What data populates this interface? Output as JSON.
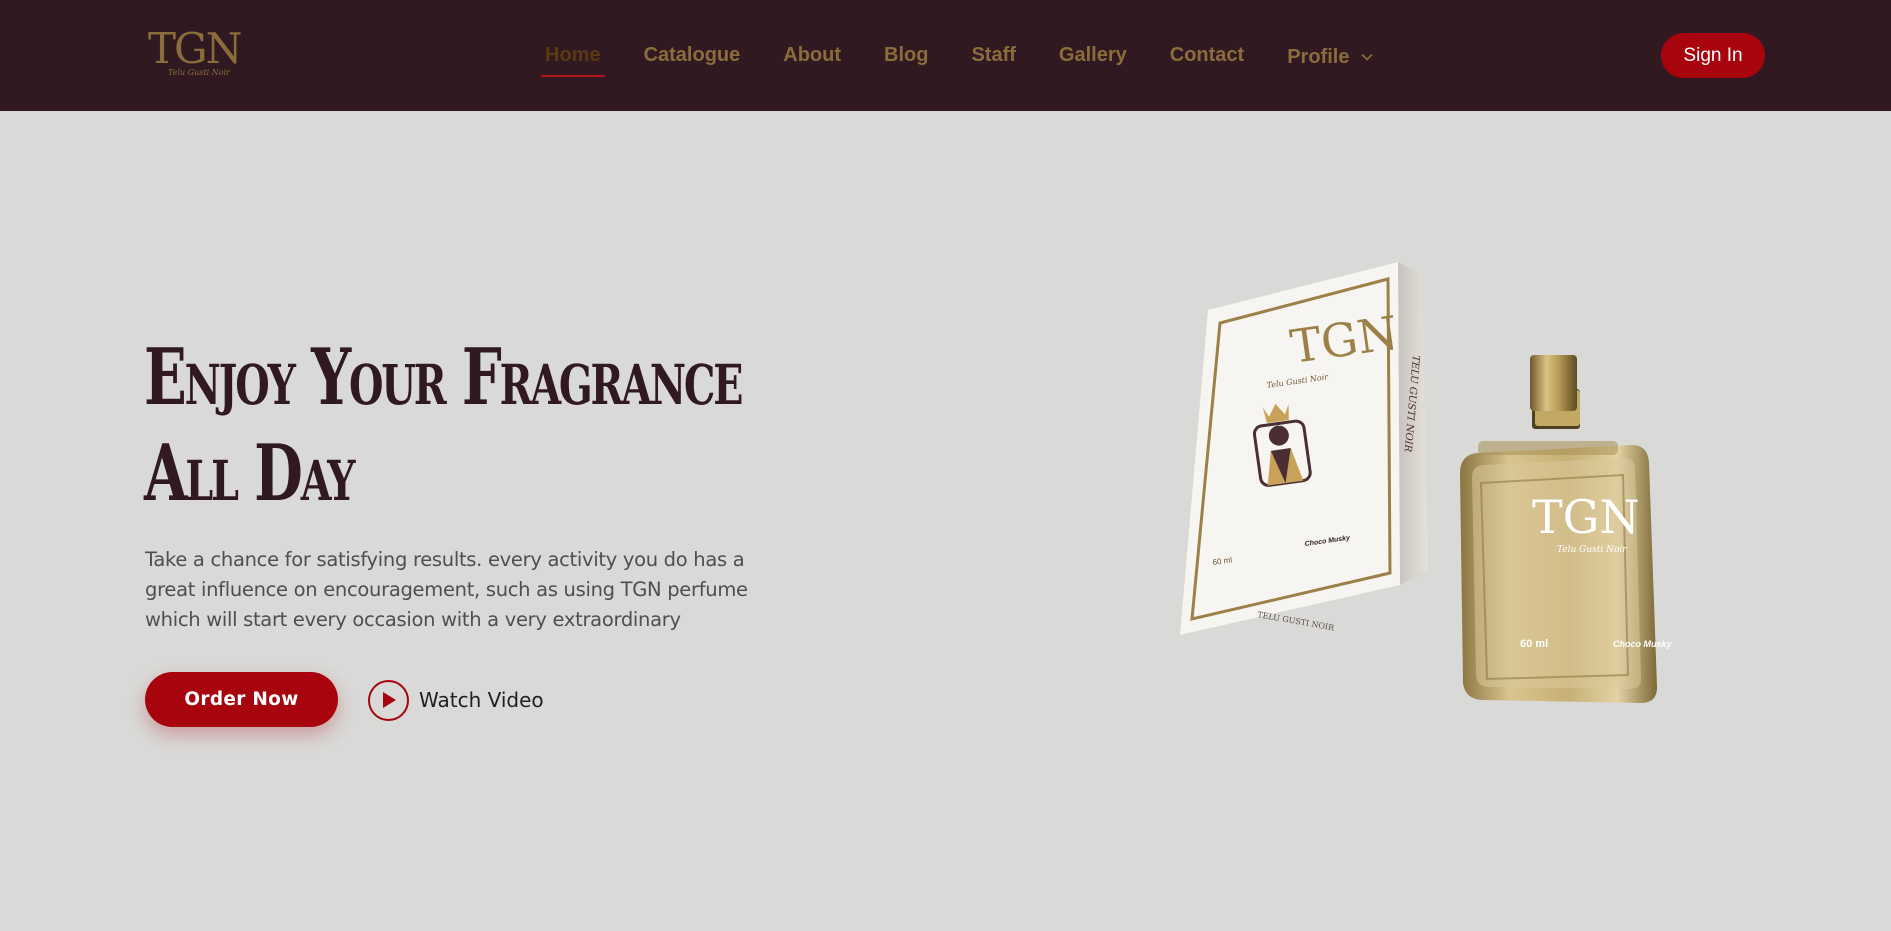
{
  "header": {
    "logo": {
      "main": "TGN",
      "sub": "Telu Gusti Noir"
    },
    "nav": [
      {
        "label": "Home",
        "active": true
      },
      {
        "label": "Catalogue",
        "active": false
      },
      {
        "label": "About",
        "active": false
      },
      {
        "label": "Blog",
        "active": false
      },
      {
        "label": "Staff",
        "active": false
      },
      {
        "label": "Gallery",
        "active": false
      },
      {
        "label": "Contact",
        "active": false
      },
      {
        "label": "Profile",
        "active": false,
        "dropdown": true
      }
    ],
    "sign_in_label": "Sign In"
  },
  "hero": {
    "title_line1": "Enjoy Your Fragrance",
    "title_line2": "All Day",
    "description": "Take a chance for satisfying results. every activity you do has a great influence on encouragement, such as using TGN perfume which will start every occasion with a very extraordinary",
    "order_label": "Order Now",
    "watch_label": "Watch Video"
  },
  "product": {
    "box_brand": "TGN",
    "box_sub": "Telu Gusti Noir",
    "box_side": "TELU GUSTI NOIR",
    "box_bottom": "TELU GUSTI NOIR",
    "box_volume": "60 ml",
    "box_scent": "Choco Musky",
    "bottle_brand": "TGN",
    "bottle_sub": "Telu Gusti Noir",
    "bottle_volume": "60 ml",
    "bottle_scent": "Choco Musky"
  },
  "colors": {
    "header_bg": "#311922",
    "page_bg": "#d9d9d7",
    "accent": "#a8040e",
    "gold": "#8a6d3b",
    "title": "#311922"
  },
  "icons": {
    "dropdown": "chevron-down-icon",
    "play": "play-icon"
  }
}
